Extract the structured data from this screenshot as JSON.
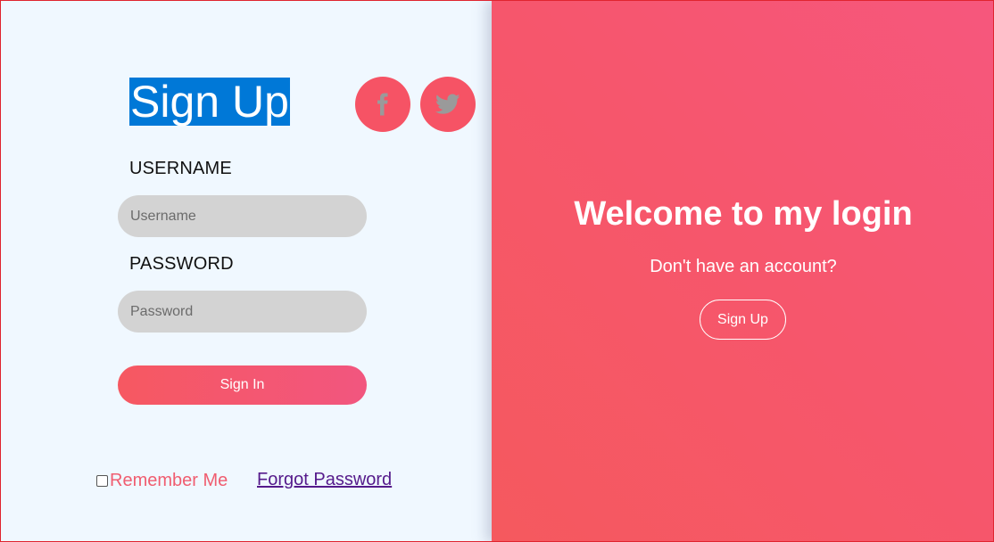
{
  "left_panel": {
    "title": "Sign Up",
    "social": [
      {
        "icon": "facebook-icon",
        "glyph": "f"
      },
      {
        "icon": "twitter-icon"
      }
    ],
    "username": {
      "label": "USERNAME",
      "placeholder": "Username",
      "value": ""
    },
    "password": {
      "label": "PASSWORD",
      "placeholder": "Password",
      "value": ""
    },
    "signin_label": "Sign In",
    "remember_label": "Remember Me",
    "remember_checked": false,
    "forgot_label": "Forgot Password"
  },
  "right_panel": {
    "heading": "Welcome to my login",
    "subtext": "Don't have an account?",
    "signup_label": "Sign Up"
  },
  "colors": {
    "accent": "#f65365",
    "title_highlight": "#0078d7",
    "input_bg": "#d3d3d3",
    "link_visited": "#551a8b",
    "panel_bg": "#f0f8ff"
  }
}
